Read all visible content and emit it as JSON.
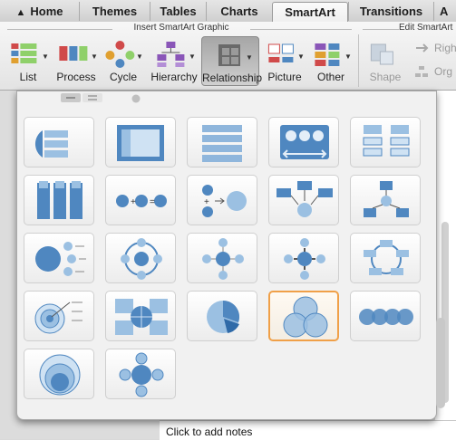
{
  "tabs": [
    {
      "label": "Home",
      "icon": "house-icon"
    },
    {
      "label": "Themes"
    },
    {
      "label": "Tables"
    },
    {
      "label": "Charts"
    },
    {
      "label": "SmartArt",
      "active": true
    },
    {
      "label": "Transitions"
    },
    {
      "label": "A"
    }
  ],
  "ribbon": {
    "insert_group_title": "Insert SmartArt Graphic",
    "edit_group_title": "Edit SmartArt",
    "buttons": [
      {
        "label": "List",
        "icon": "list-layout-icon"
      },
      {
        "label": "Process",
        "icon": "process-layout-icon"
      },
      {
        "label": "Cycle",
        "icon": "cycle-layout-icon"
      },
      {
        "label": "Hierarchy",
        "icon": "hierarchy-layout-icon"
      },
      {
        "label": "Relationship",
        "icon": "relationship-layout-icon",
        "selected": true
      },
      {
        "label": "Picture",
        "icon": "picture-layout-icon"
      },
      {
        "label": "Other",
        "icon": "other-layout-icon"
      }
    ],
    "edit_buttons": [
      {
        "label": "Shape",
        "icon": "shape-icon",
        "disabled": true
      },
      {
        "label": "Righ",
        "icon": "right-to-left-icon",
        "disabled": true
      },
      {
        "label": "Org",
        "icon": "org-chart-icon",
        "disabled": true
      }
    ]
  },
  "gallery": {
    "items": [
      {
        "name": "balance-graphic",
        "selected": false
      },
      {
        "name": "table-grid-graphic",
        "selected": false
      },
      {
        "name": "stacked-list-graphic",
        "selected": false
      },
      {
        "name": "counterbalance-arrows-graphic",
        "selected": false
      },
      {
        "name": "grouped-list-graphic",
        "selected": false
      },
      {
        "name": "vertical-bracket-graphic",
        "selected": false
      },
      {
        "name": "equation-graphic",
        "selected": false
      },
      {
        "name": "plus-equals-graphic",
        "selected": false
      },
      {
        "name": "converging-arrows-graphic",
        "selected": false
      },
      {
        "name": "hierarchy-relationship-graphic",
        "selected": false
      },
      {
        "name": "radial-list-graphic",
        "selected": false
      },
      {
        "name": "radial-cycle-graphic",
        "selected": false
      },
      {
        "name": "basic-radial-graphic",
        "selected": false
      },
      {
        "name": "diverging-radial-graphic",
        "selected": false
      },
      {
        "name": "cycle-matrix-graphic",
        "selected": false
      },
      {
        "name": "target-list-graphic",
        "selected": false
      },
      {
        "name": "cycle-matrix-quad-graphic",
        "selected": false
      },
      {
        "name": "pie-graphic",
        "selected": false
      },
      {
        "name": "basic-venn-graphic",
        "selected": true
      },
      {
        "name": "linear-venn-graphic",
        "selected": false
      },
      {
        "name": "stacked-venn-graphic",
        "selected": false
      },
      {
        "name": "radial-venn-graphic",
        "selected": false
      }
    ]
  },
  "notes": {
    "placeholder": "Click to add notes"
  },
  "colors": {
    "accent": "#4f87c0",
    "selection": "#f0a048"
  }
}
